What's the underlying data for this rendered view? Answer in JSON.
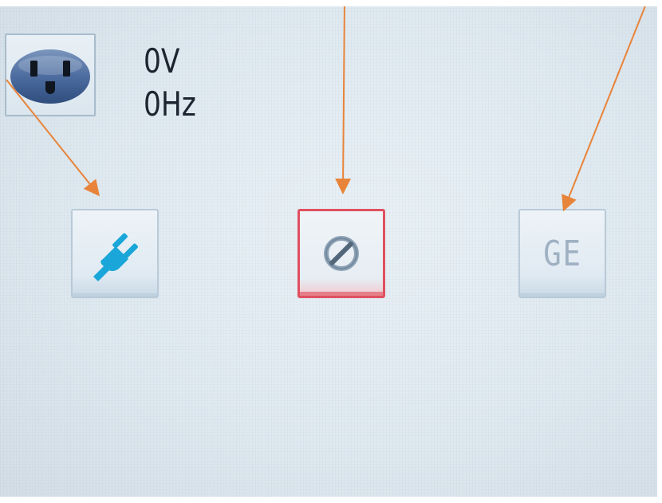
{
  "readout": {
    "voltage": "0V",
    "frequency": "0Hz"
  },
  "icons": {
    "outlet": "power-outlet-icon",
    "power": "power-plug-icon",
    "stop": "prohibited-icon"
  },
  "buttons": {
    "ge_label": "GE"
  },
  "colors": {
    "plug_blue": "#1aa6d9",
    "stop_red": "#e05060",
    "annotation_arrow": "#e8843a"
  }
}
